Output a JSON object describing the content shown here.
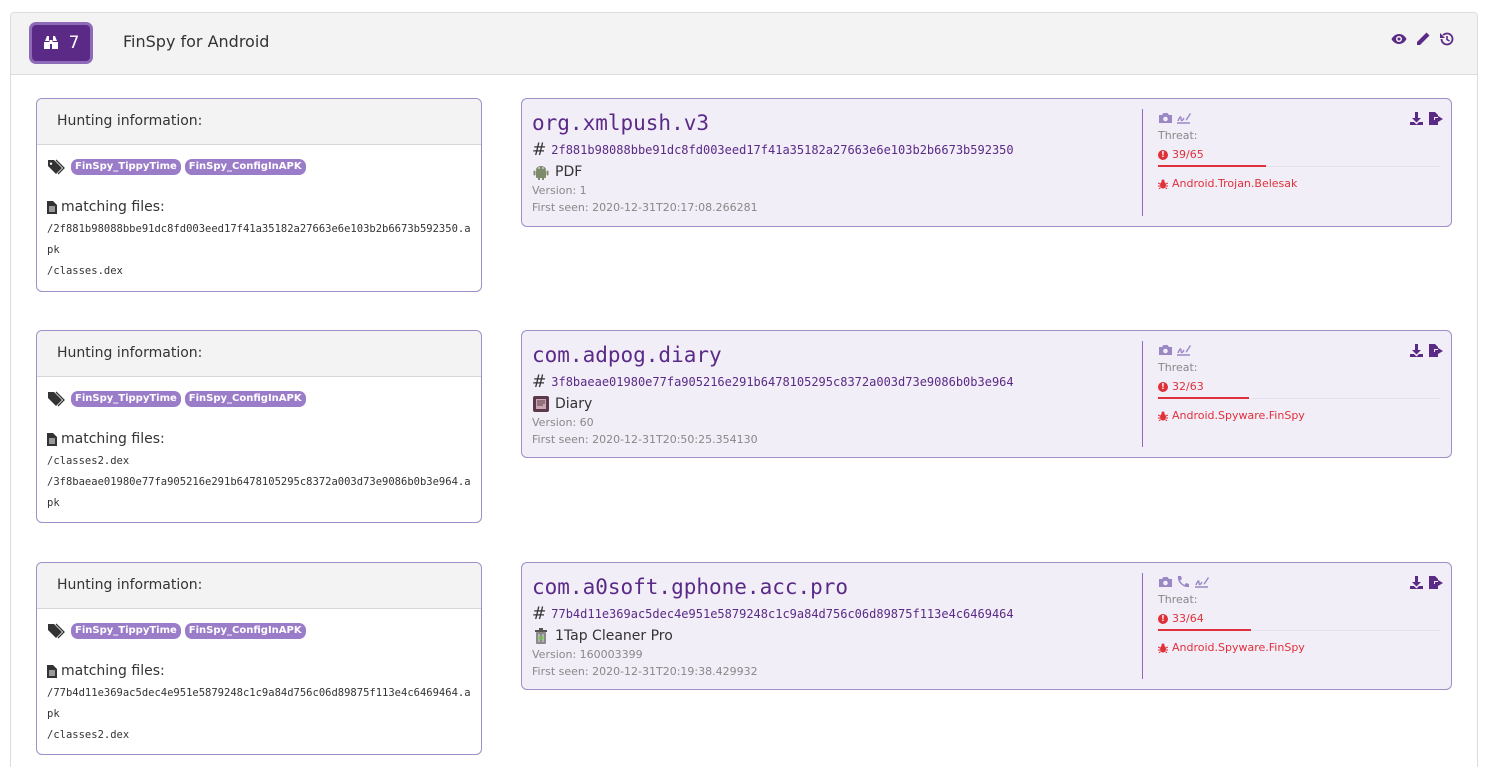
{
  "header": {
    "badge_count": "7",
    "title": "FinSpy for Android",
    "actions": [
      "eye-icon",
      "pencil-icon",
      "history-icon"
    ]
  },
  "colors": {
    "brand": "#5b2a86",
    "tag": "#9b7cc9",
    "threat": "#e0303a",
    "card_bg": "#f1eef8"
  },
  "hunting_label": "Hunting information:",
  "matching_label": "matching files:",
  "threat_label": "Threat:",
  "rules": [
    {
      "tags": [
        "FinSpy_TippyTime",
        "FinSpy_ConfigInAPK"
      ],
      "files": [
        "/2f881b98088bbe91dc8fd003eed17f41a35182a27663e6e103b2b6673b592350.apk",
        "/classes.dex"
      ],
      "app": {
        "package": "org.xmlpush.v3",
        "sha256": "2f881b98088bbe91dc8fd003eed17f41a35182a27663e6e103b2b6673b592350",
        "name": "PDF",
        "icon": "android-robot-icon",
        "version": "Version: 1",
        "first_seen": "First seen: 2020-12-31T20:17:08.266281",
        "threat_score": "39/65",
        "threat_fraction": 0.6,
        "malware": "Android.Trojan.Belesak",
        "side_icons": [
          "camera-icon",
          "signature-icon"
        ]
      }
    },
    {
      "tags": [
        "FinSpy_TippyTime",
        "FinSpy_ConfigInAPK"
      ],
      "files": [
        "/classes2.dex",
        "/3f8baeae01980e77fa905216e291b6478105295c8372a003d73e9086b0b3e964.apk"
      ],
      "app": {
        "package": "com.adpog.diary",
        "sha256": "3f8baeae01980e77fa905216e291b6478105295c8372a003d73e9086b0b3e964",
        "name": "Diary",
        "icon": "diary-app-icon",
        "version": "Version: 60",
        "first_seen": "First seen: 2020-12-31T20:50:25.354130",
        "threat_score": "32/63",
        "threat_fraction": 0.508,
        "malware": "Android.Spyware.FinSpy",
        "side_icons": [
          "camera-icon",
          "signature-icon"
        ]
      }
    },
    {
      "tags": [
        "FinSpy_TippyTime",
        "FinSpy_ConfigInAPK"
      ],
      "files": [
        "/77b4d11e369ac5dec4e951e5879248c1c9a84d756c06d89875f113e4c6469464.apk",
        "/classes2.dex"
      ],
      "app": {
        "package": "com.a0soft.gphone.acc.pro",
        "sha256": "77b4d11e369ac5dec4e951e5879248c1c9a84d756c06d89875f113e4c6469464",
        "name": "1Tap Cleaner Pro",
        "icon": "trash-can-icon",
        "version": "Version: 160003399",
        "first_seen": "First seen: 2020-12-31T20:19:38.429932",
        "threat_score": "33/64",
        "threat_fraction": 0.516,
        "malware": "Android.Spyware.FinSpy",
        "side_icons": [
          "camera-icon",
          "phone-icon",
          "signature-icon"
        ]
      }
    }
  ]
}
